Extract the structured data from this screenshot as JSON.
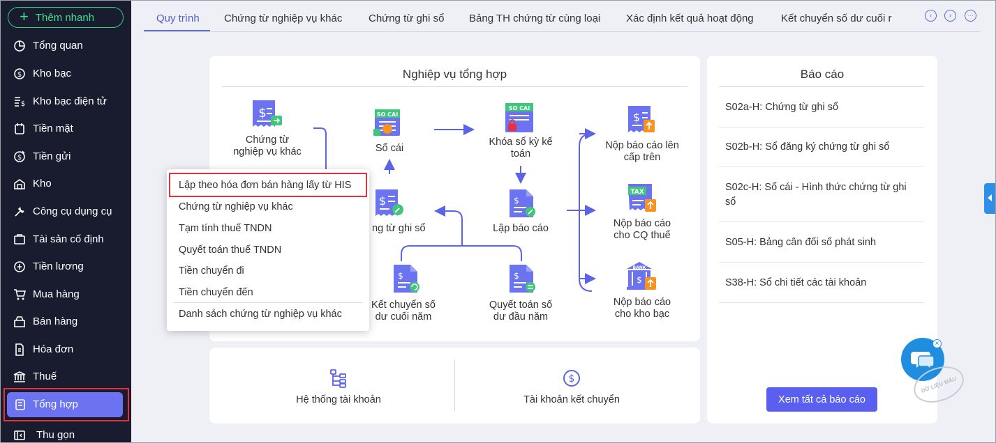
{
  "sidebar": {
    "quick_add": "Thêm nhanh",
    "items": [
      {
        "label": "Tổng quan",
        "icon": "pie-chart-icon"
      },
      {
        "label": "Kho bạc",
        "icon": "coin-icon"
      },
      {
        "label": "Kho bạc điện tử",
        "icon": "e-treasury-icon"
      },
      {
        "label": "Tiền mặt",
        "icon": "cash-icon"
      },
      {
        "label": "Tiền gửi",
        "icon": "deposit-icon"
      },
      {
        "label": "Kho",
        "icon": "warehouse-icon"
      },
      {
        "label": "Công cụ dụng cụ",
        "icon": "tools-icon"
      },
      {
        "label": "Tài sản cố định",
        "icon": "asset-icon"
      },
      {
        "label": "Tiền lương",
        "icon": "salary-icon"
      },
      {
        "label": "Mua hàng",
        "icon": "cart-icon"
      },
      {
        "label": "Bán hàng",
        "icon": "sales-icon"
      },
      {
        "label": "Hóa đơn",
        "icon": "invoice-icon"
      },
      {
        "label": "Thuế",
        "icon": "tax-building-icon"
      },
      {
        "label": "Tổng hợp",
        "icon": "summary-icon",
        "active": true
      }
    ],
    "collapse": "Thu gọn"
  },
  "tabs": [
    "Quy trình",
    "Chứng từ nghiệp vụ khác",
    "Chứng từ ghi sổ",
    "Bảng TH chứng từ cùng loại",
    "Xác định kết quả hoạt động",
    "Kết chuyển số dư cuối r"
  ],
  "tab_nav": {
    "prev": "‹",
    "next": "›",
    "more": "···"
  },
  "process": {
    "title": "Nghiệp vụ tổng hợp",
    "nodes": {
      "ctnvk_1": "Chứng từ",
      "ctnvk_2": "nghiệp vụ khác",
      "socai": "Sổ cái",
      "khoaso_1": "Khóa sổ kỳ kế",
      "khoaso_2": "toán",
      "nopcaptren_1": "Nộp báo cáo lên",
      "nopcaptren_2": "cấp trên",
      "ctghiso": "ng từ ghi sổ",
      "lapbaocao": "Lập báo cáo",
      "nopthue_1": "Nộp báo cáo",
      "nopthue_2": "cho CQ thuế",
      "ketchuyen_1": "Kết chuyển số",
      "ketchuyen_2": "dư cuối năm",
      "quyettoan_1": "Quyết toán số",
      "quyettoan_2": "dư đầu năm",
      "nopkhobac_1": "Nộp báo cáo",
      "nopkhobac_2": "cho kho bạc"
    },
    "badges": {
      "socai": "SO CAI",
      "khoaso": "SO CAI",
      "tax": "TAX",
      "bank": "BANK"
    }
  },
  "bottom": {
    "accounts": "Hệ thống tài khoản",
    "transfer": "Tài khoản kết chuyển"
  },
  "reports": {
    "title": "Báo cáo",
    "items": [
      "S02a-H: Chứng từ ghi sổ",
      "S02b-H: Sổ đăng ký chứng từ ghi sổ",
      "S02c-H: Sổ cái - Hình thức chứng từ ghi",
      "sổ",
      "S05-H: Bảng cân đối số phát sinh",
      "S38-H: Sổ chi tiết các tài khoản"
    ],
    "see_all": "Xem tất cả báo cáo"
  },
  "dropdown": [
    "Lập theo hóa đơn bán hàng lấy từ HIS",
    "Chứng từ nghiệp vụ khác",
    "Tạm tính thuế TNDN",
    "Quyết toán thuế TNDN",
    "Tiền chuyển đi",
    "Tiền chuyển đến",
    "Danh sách chứng từ nghiệp vụ khác"
  ],
  "watermark": "DỮ LIỆU MẪU",
  "colors": {
    "sidebar": "#181c2e",
    "accent": "#5b6be0",
    "active": "#6b73f0",
    "green": "#3be08b",
    "orange": "#f7931e",
    "highlight": "#e8313c"
  }
}
